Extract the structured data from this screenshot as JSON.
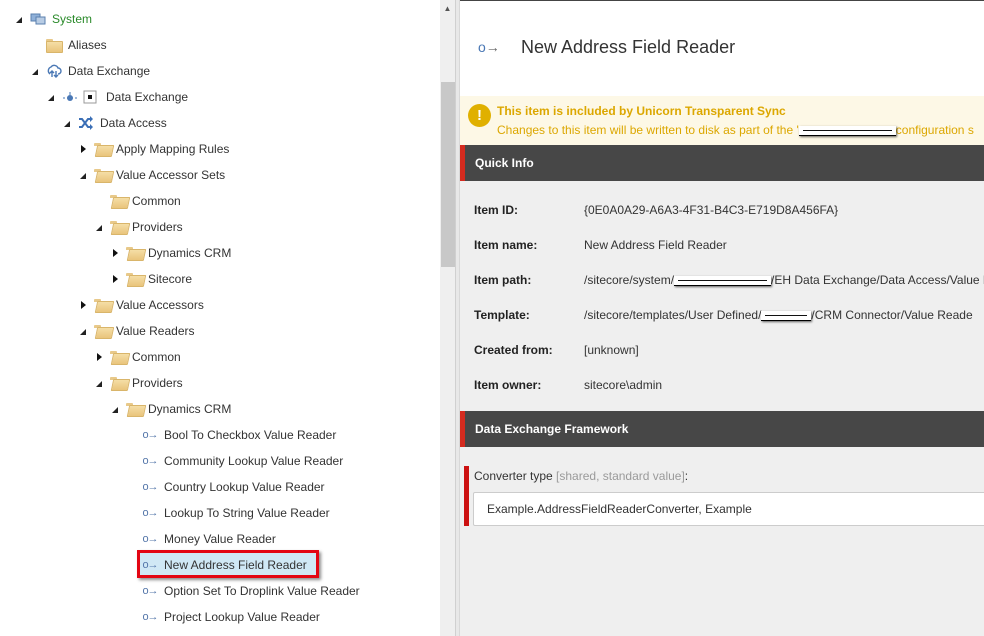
{
  "tree": {
    "nodes": [
      {
        "label": "System",
        "icon": "system-icon",
        "state": "expanded",
        "color": "#2a8a2a"
      },
      {
        "label": "Aliases",
        "icon": "folder-icon",
        "state": "leaf"
      },
      {
        "label": "Data Exchange",
        "icon": "cloud-sync-icon",
        "state": "expanded"
      },
      {
        "label": "Data Exchange",
        "icon": "tenant-icon",
        "state": "expanded"
      },
      {
        "label": "Data Access",
        "icon": "shuffle-icon",
        "state": "expanded"
      },
      {
        "label": "Apply Mapping Rules",
        "icon": "folder-icon",
        "state": "collapsed"
      },
      {
        "label": "Value Accessor Sets",
        "icon": "folder-icon",
        "state": "expanded"
      },
      {
        "label": "Common",
        "icon": "folder-icon",
        "state": "leaf"
      },
      {
        "label": "Providers",
        "icon": "folder-icon",
        "state": "expanded"
      },
      {
        "label": "Dynamics CRM",
        "icon": "folder-icon",
        "state": "collapsed"
      },
      {
        "label": "Sitecore",
        "icon": "folder-icon",
        "state": "collapsed"
      },
      {
        "label": "Value Accessors",
        "icon": "folder-icon",
        "state": "collapsed"
      },
      {
        "label": "Value Readers",
        "icon": "folder-icon",
        "state": "expanded"
      },
      {
        "label": "Common",
        "icon": "folder-icon",
        "state": "collapsed"
      },
      {
        "label": "Providers",
        "icon": "folder-icon",
        "state": "expanded"
      },
      {
        "label": "Dynamics CRM",
        "icon": "folder-icon",
        "state": "expanded"
      },
      {
        "label": "Bool To Checkbox Value Reader",
        "icon": "value-reader-icon",
        "state": "leaf"
      },
      {
        "label": "Community Lookup Value Reader",
        "icon": "value-reader-icon",
        "state": "leaf"
      },
      {
        "label": "Country Lookup Value Reader",
        "icon": "value-reader-icon",
        "state": "leaf"
      },
      {
        "label": "Lookup To String Value Reader",
        "icon": "value-reader-icon",
        "state": "leaf"
      },
      {
        "label": "Money Value Reader",
        "icon": "value-reader-icon",
        "state": "leaf"
      },
      {
        "label": "New Address Field Reader",
        "icon": "value-reader-icon",
        "state": "leaf",
        "selected": true
      },
      {
        "label": "Option Set To Droplink Value Reader",
        "icon": "value-reader-icon",
        "state": "leaf"
      },
      {
        "label": "Project Lookup Value Reader",
        "icon": "value-reader-icon",
        "state": "leaf"
      }
    ],
    "reader_glyph": "o→"
  },
  "header": {
    "title": "New Address Field Reader",
    "icon_glyph": "→"
  },
  "warning": {
    "title": "This item is included by Unicorn Transparent Sync",
    "text_before": "Changes to this item will be written to disk as part of the '",
    "text_after": "configuration s",
    "color": "#dca700"
  },
  "quick_info": {
    "title": "Quick Info",
    "rows": [
      {
        "key": "Item ID:",
        "value": "{0E0A0A29-A6A3-4F31-B4C3-E719D8A456FA}"
      },
      {
        "key": "Item name:",
        "value": "New Address Field Reader"
      },
      {
        "key": "Item path:",
        "value_before": "/sitecore/system/",
        "value_after": "/EH Data Exchange/Data Access/Value R"
      },
      {
        "key": "Template:",
        "value_before": "/sitecore/templates/User Defined/",
        "value_after": "/CRM Connector/Value Reade"
      },
      {
        "key": "Created from:",
        "value": "[unknown]"
      },
      {
        "key": "Item owner:",
        "value": "sitecore\\admin"
      }
    ]
  },
  "dxf_section": {
    "title": "Data Exchange Framework",
    "field_label": "Converter type",
    "field_meta": "[shared, standard value]",
    "field_colon": ":",
    "field_value": "Example.AddressFieldReaderConverter, Example"
  },
  "colors": {
    "accent_red": "#d42b1f",
    "section_bg": "#474747",
    "selection_border": "#e30613"
  }
}
